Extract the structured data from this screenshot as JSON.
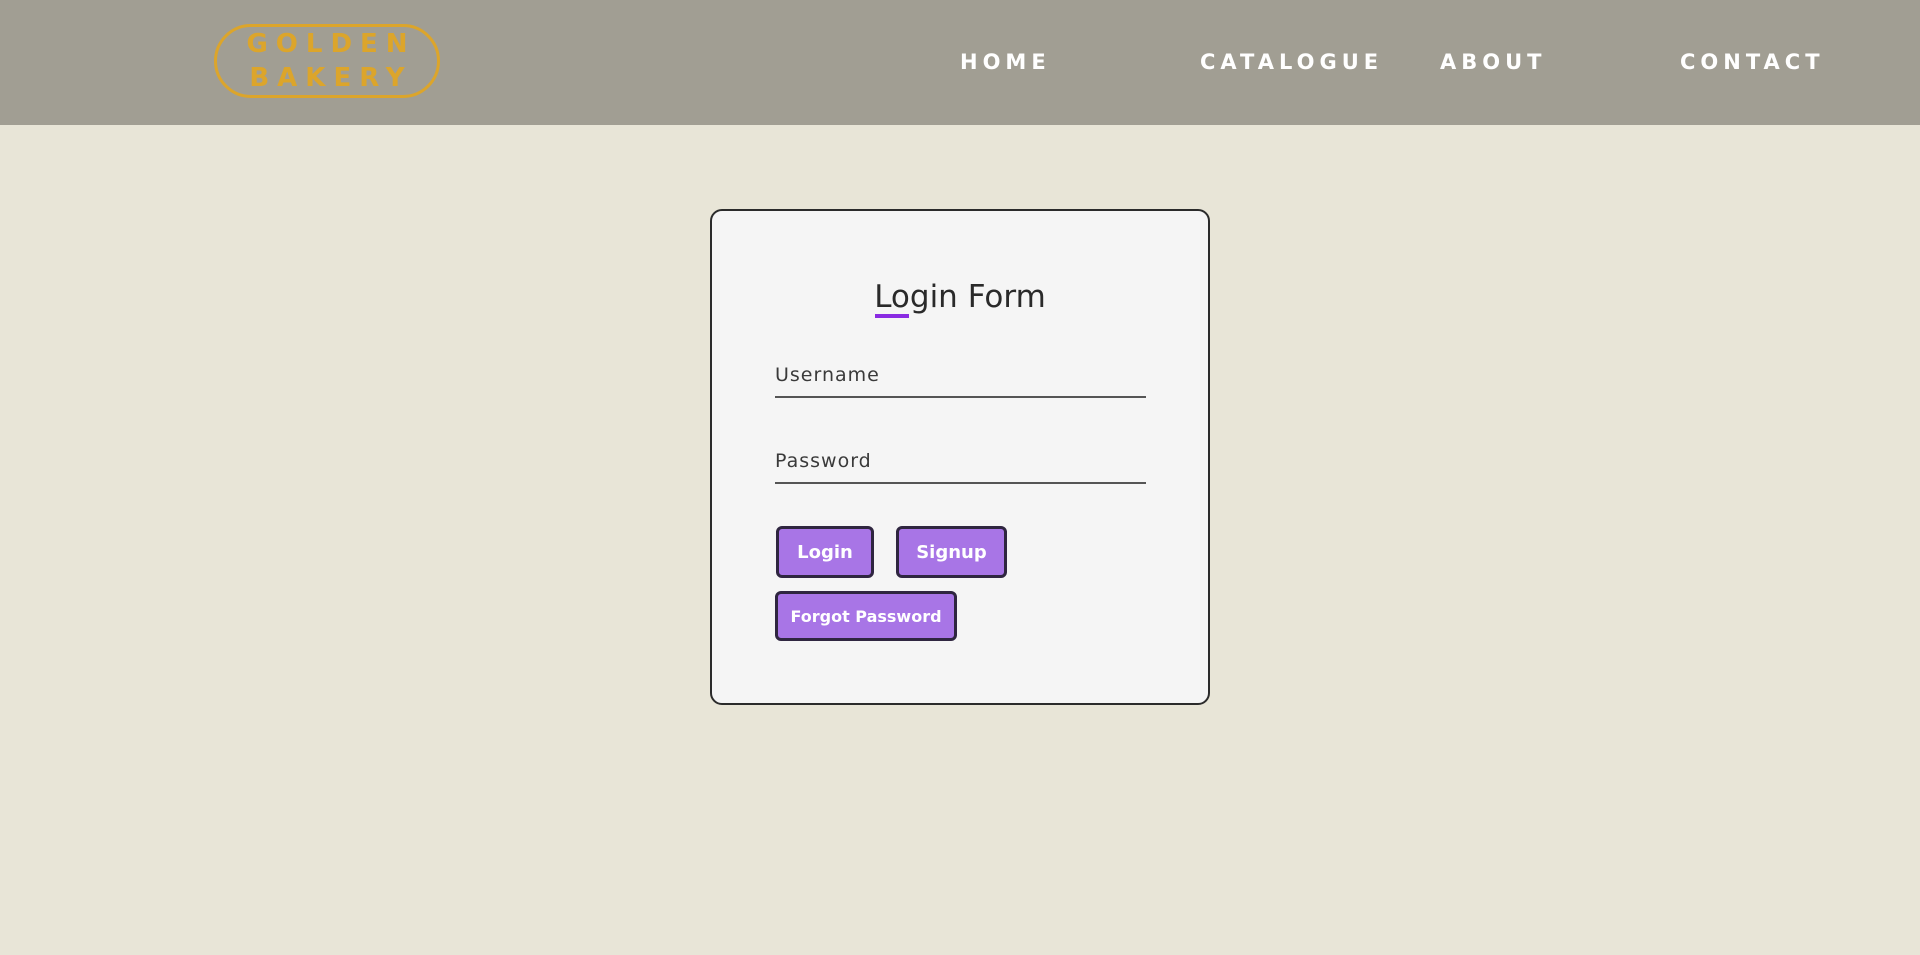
{
  "header": {
    "logo": {
      "line1": "GOLDEN",
      "line2": "BAKERY"
    },
    "nav": {
      "home": "HOME",
      "catalogue": "CATALOGUE",
      "about": "ABOUT",
      "contact": "CONTACT"
    }
  },
  "login_form": {
    "title": "Login Form",
    "username": {
      "placeholder": "Username",
      "value": ""
    },
    "password": {
      "placeholder": "Password",
      "value": ""
    },
    "buttons": {
      "login": "Login",
      "signup": "Signup",
      "forgot_password": "Forgot Password"
    }
  },
  "colors": {
    "header_bg": "#a19e93",
    "page_bg": "#e8e5d7",
    "logo_gold": "#dca52b",
    "button_purple": "#a875e6",
    "title_accent": "#8a2be2"
  }
}
